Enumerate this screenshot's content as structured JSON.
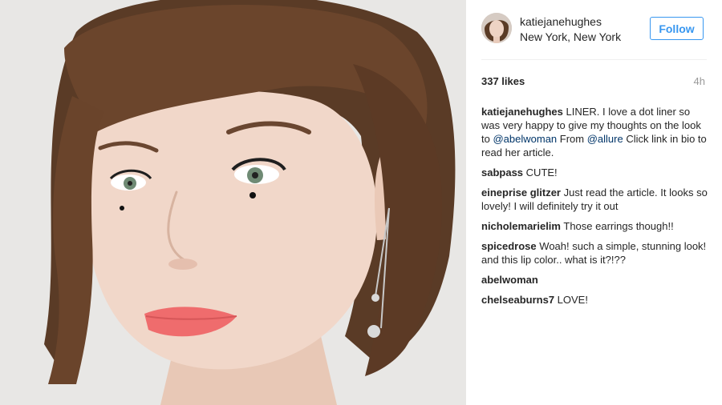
{
  "post": {
    "username": "katiejanehughes",
    "location": "New York, New York",
    "follow_label": "Follow",
    "likes": "337 likes",
    "time": "4h",
    "caption": {
      "user": "katiejanehughes",
      "text_1": "LINER. I love a dot liner so was very happy to give my thoughts on the look to ",
      "mention_1": "@abelwoman",
      "text_2": " From ",
      "mention_2": "@allure",
      "text_3": " Click link in bio to read her article."
    },
    "comments": [
      {
        "user": "sabpass",
        "text": "CUTE!"
      },
      {
        "user": "eineprise glitzer",
        "text": "Just read the article. It looks so lovely! I will definitely try it out"
      },
      {
        "user": "nicholemarielim",
        "text": "Those earrings though!!"
      },
      {
        "user": "spicedrose",
        "text": "Woah! such a simple, stunning look! and this lip color.. what is it?!??"
      },
      {
        "user": "abelwoman",
        "text": ""
      },
      {
        "user": "chelseaburns7",
        "text": "LOVE!"
      }
    ]
  },
  "colors": {
    "accent": "#3897f0",
    "mention": "#003569",
    "muted": "#999999",
    "text": "#262626"
  },
  "icons": {
    "avatar": "profile-photo",
    "photo": "portrait-photo"
  }
}
